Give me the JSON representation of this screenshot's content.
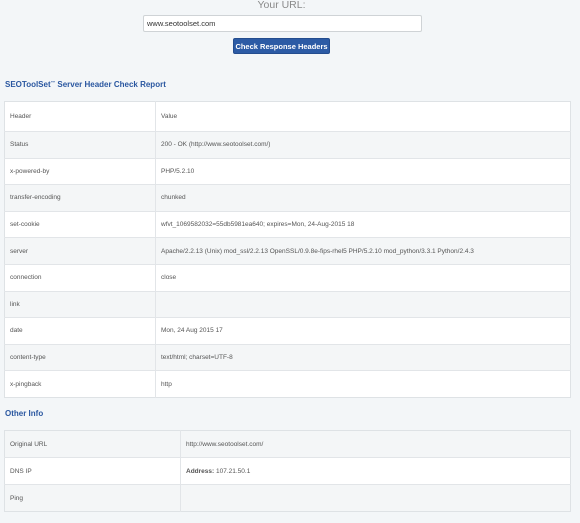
{
  "form": {
    "label": "Your URL:",
    "url_value": "www.seotoolset.com",
    "button_label": "Check Response Headers"
  },
  "report": {
    "title_brand": "SEOToolSet",
    "title_mark": "™",
    "title_rest": " Server Header Check Report",
    "columns": [
      "Header",
      "Value"
    ],
    "rows": [
      {
        "header": "Status",
        "value": "200 - OK (http://www.seotoolset.com/)"
      },
      {
        "header": "x-powered-by",
        "value": "PHP/5.2.10"
      },
      {
        "header": "transfer-encoding",
        "value": "chunked"
      },
      {
        "header": "set-cookie",
        "value": "wfvt_1069582032=55db5981ea640; expires=Mon, 24-Aug-2015 18"
      },
      {
        "header": "server",
        "value": "Apache/2.2.13 (Unix) mod_ssl/2.2.13 OpenSSL/0.9.8e-fips-rhel5 PHP/5.2.10 mod_python/3.3.1 Python/2.4.3"
      },
      {
        "header": "connection",
        "value": "close"
      },
      {
        "header": "link",
        "value": ""
      },
      {
        "header": "date",
        "value": "Mon, 24 Aug 2015 17"
      },
      {
        "header": "content-type",
        "value": "text/html; charset=UTF-8"
      },
      {
        "header": "x-pingback",
        "value": "http"
      }
    ]
  },
  "other_info": {
    "title": "Other Info",
    "rows": [
      {
        "label": "Original URL",
        "value": "http://www.seotoolset.com/"
      },
      {
        "label": "DNS IP",
        "value_label": "Address:",
        "value": "107.21.50.1"
      },
      {
        "label": "Ping",
        "value": ""
      }
    ]
  }
}
